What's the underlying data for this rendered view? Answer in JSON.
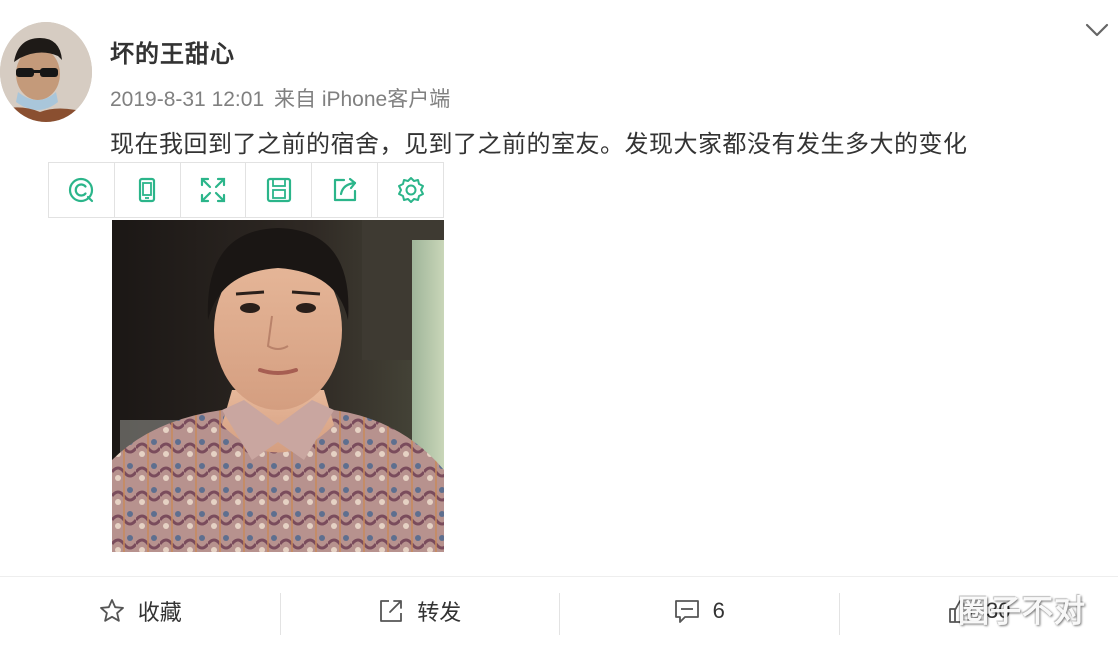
{
  "post": {
    "author_name": "坏的王甜心",
    "timestamp": "2019-8-31 12:01",
    "source": "来自 iPhone客户端",
    "text": "现在我回到了之前的宿舍，见到了之前的室友。发现大家都没有发生多大的变化"
  },
  "image_toolbar": {
    "icons": [
      "zoom-icon",
      "rotate-icon",
      "fullscreen-icon",
      "save-icon",
      "share-icon",
      "settings-icon"
    ]
  },
  "actions": {
    "favorite_label": "收藏",
    "repost_label": "转发",
    "comment_count": "6",
    "like_count": "30"
  },
  "watermark": "圈子不对",
  "colors": {
    "accent": "#2bb58a",
    "text": "#333333",
    "meta": "#808080",
    "border": "#e2e2e2"
  }
}
